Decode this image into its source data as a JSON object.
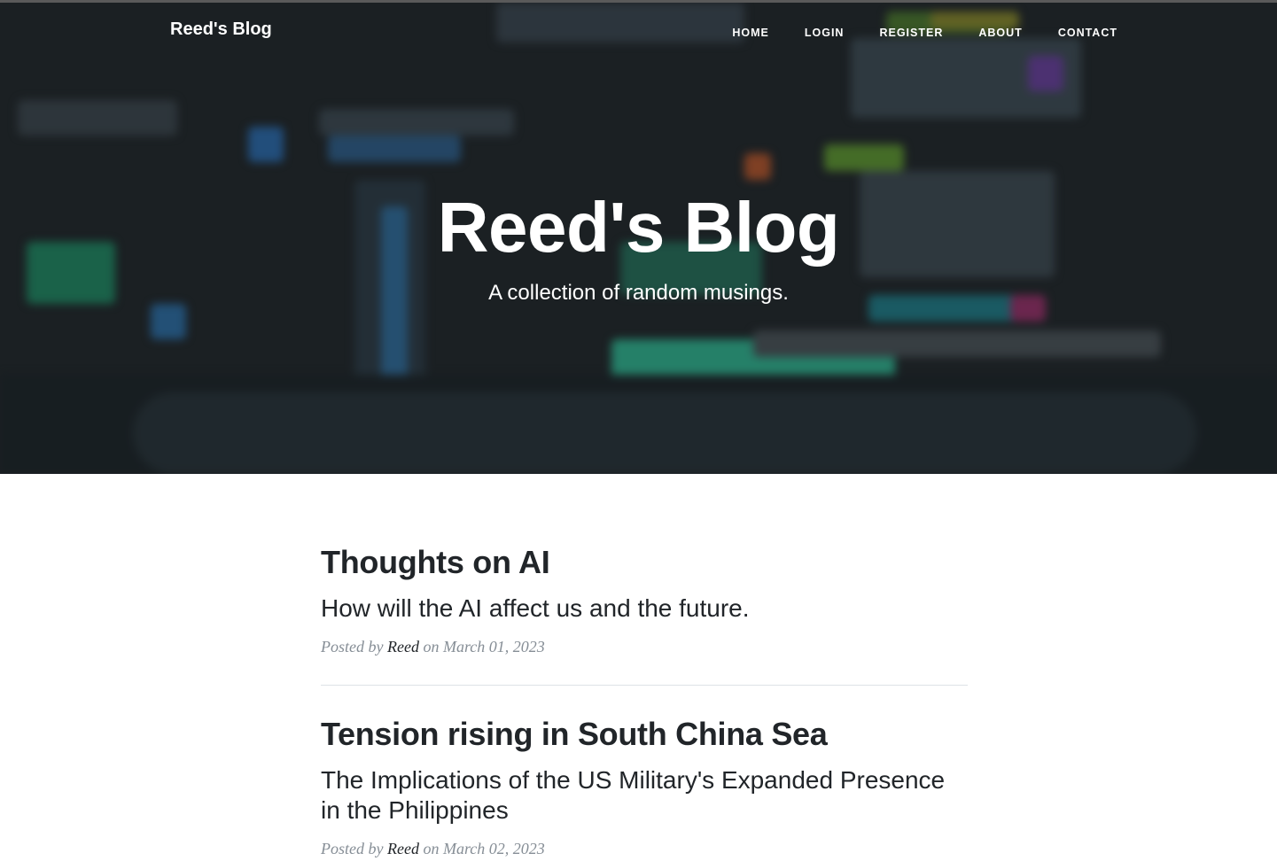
{
  "navbar": {
    "brand": "Reed's Blog",
    "links": [
      "HOME",
      "LOGIN",
      "REGISTER",
      "ABOUT",
      "CONTACT"
    ]
  },
  "header": {
    "title": "Reed's Blog",
    "subtitle": "A collection of random musings."
  },
  "posts": [
    {
      "title": "Thoughts on AI",
      "subtitle": "How will the AI affect us and the future.",
      "posted_by": "Posted by",
      "author": "Reed",
      "on": "on",
      "date": "March 01, 2023"
    },
    {
      "title": "Tension rising in South China Sea",
      "subtitle": "The Implications of the US Military's Expanded Presence in the Philippines",
      "posted_by": "Posted by",
      "author": "Reed",
      "on": "on",
      "date": "March 02, 2023"
    }
  ],
  "colors": {
    "text": "#212529",
    "meta": "#868e96",
    "background_dark": "#1f2528"
  }
}
